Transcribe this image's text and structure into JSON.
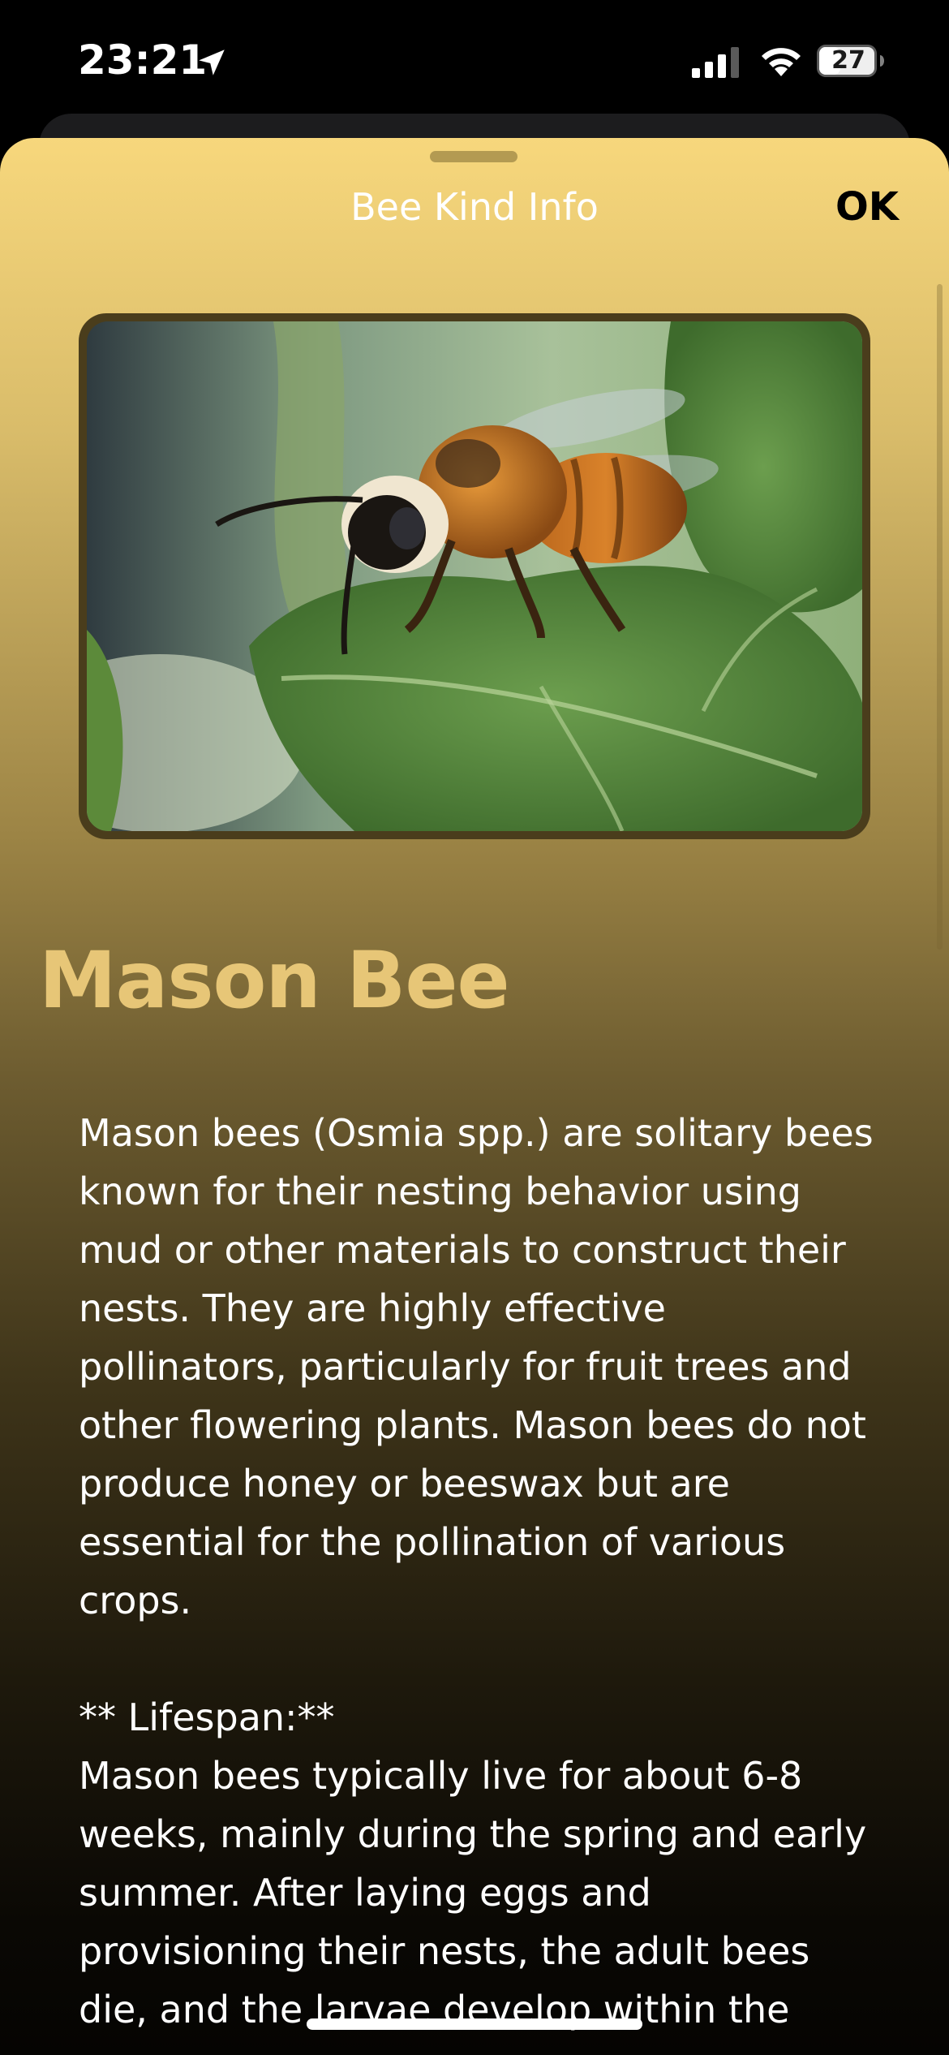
{
  "status_bar": {
    "time": "23:21",
    "battery": "27",
    "icons": [
      "location-arrow-icon",
      "cellular-signal-icon",
      "wifi-icon",
      "battery-icon"
    ]
  },
  "sheet": {
    "title": "Bee Kind Info",
    "ok_label": "OK"
  },
  "bee": {
    "name": "Mason Bee",
    "photo_subject": "mason bee on green leaf",
    "description": "Mason bees (Osmia spp.) are solitary bees known for their nesting behavior using mud or other materials to construct their nests. They are highly effective pollinators, particularly for fruit trees and other flowering plants. Mason bees do not produce honey or beeswax but are essential for the pollination of various crops.\n\n** Lifespan:**\nMason bees typically live for about 6-8 weeks, mainly during the spring and early summer. After laying eggs and provisioning their nests, the adult bees die, and the larvae develop within the"
  },
  "colors": {
    "sheet_top": "#f7d77c",
    "sheet_bottom": "#050402",
    "heading": "#e7c677",
    "photo_frame": "#4a3d1c"
  }
}
